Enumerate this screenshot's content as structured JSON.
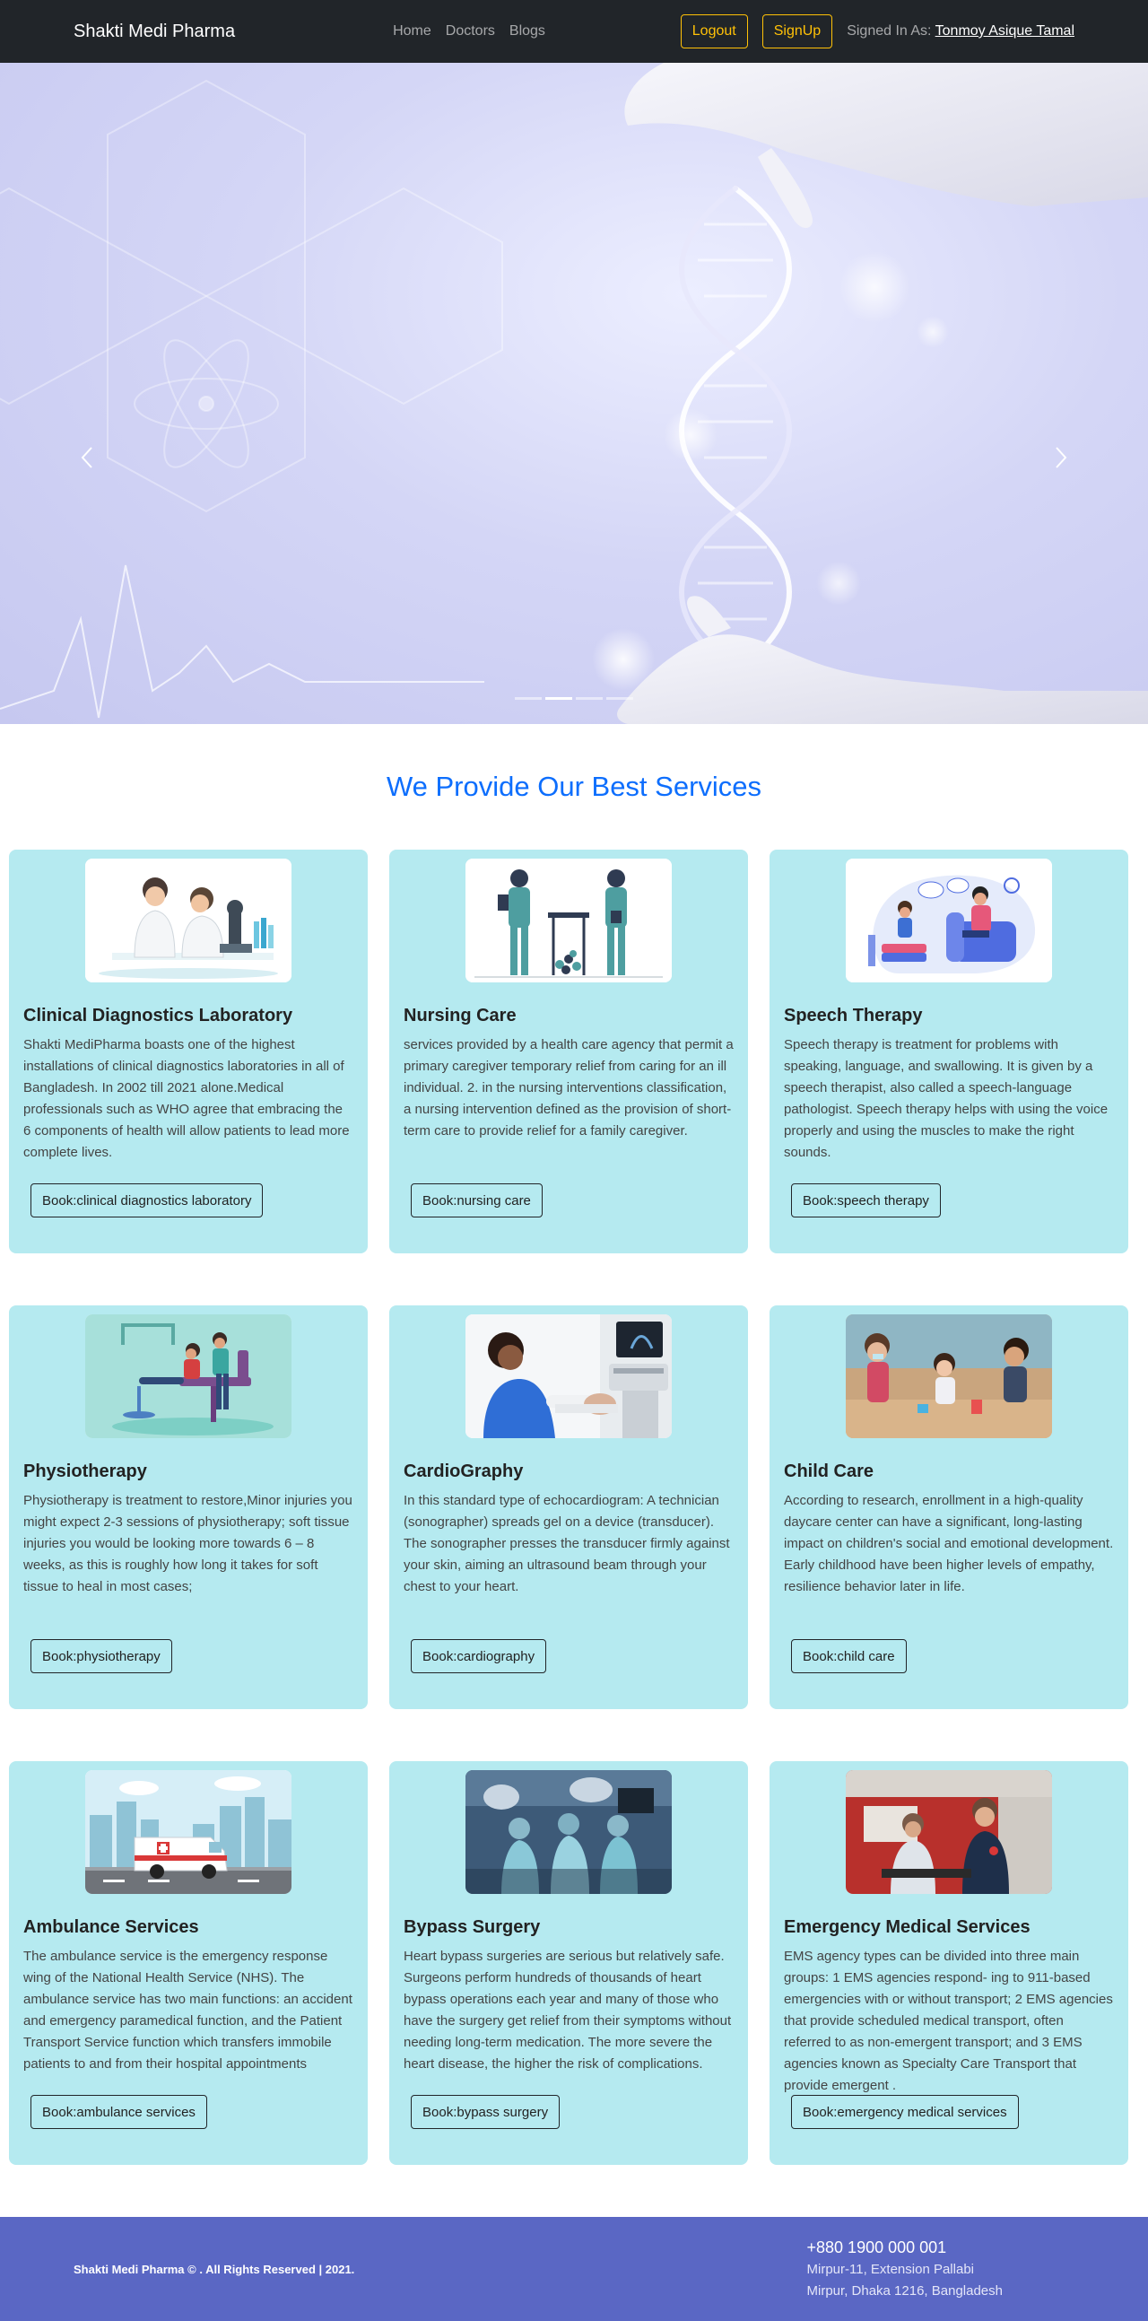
{
  "nav": {
    "brand": "Shakti Medi Pharma",
    "links": [
      "Home",
      "Doctors",
      "Blogs"
    ],
    "logout_label": "Logout",
    "signup_label": "SignUp",
    "signed_in_prefix": "Signed In As:",
    "signed_in_user": "Tonmoy Asique Tamal"
  },
  "hero": {
    "prev_icon": "chevron-left-icon",
    "next_icon": "chevron-right-icon",
    "slide_count": 4,
    "active_slide": 2
  },
  "services": {
    "title": "We Provide Our Best Services",
    "cards": [
      {
        "title": "Clinical Diagnostics Laboratory",
        "text": "Shakti MediPharma boasts one of the highest installations of clinical diagnostics laboratories in all of Bangladesh. In 2002 till 2021 alone.Medical professionals such as WHO agree that embracing the 6 components of health will allow patients to lead more complete lives.",
        "button": "Book:clinical diagnostics laboratory"
      },
      {
        "title": "Nursing Care",
        "text": "services provided by a health care agency that permit a primary caregiver temporary relief from caring for an ill individual. 2. in the nursing interventions classification, a nursing intervention defined as the provision of short-term care to provide relief for a family caregiver.",
        "button": "Book:nursing care"
      },
      {
        "title": "Speech Therapy",
        "text": "Speech therapy is treatment for problems with speaking, language, and swallowing. It is given by a speech therapist, also called a speech-language pathologist. Speech therapy helps with using the voice properly and using the muscles to make the right sounds.",
        "button": "Book:speech therapy"
      },
      {
        "title": "Physiotherapy",
        "text": "Physiotherapy is treatment to restore,Minor injuries you might expect 2-3 sessions of physiotherapy; soft tissue injuries you would be looking more towards 6 – 8 weeks, as this is roughly how long it takes for soft tissue to heal in most cases;",
        "button": "Book:physiotherapy"
      },
      {
        "title": "CardioGraphy",
        "text": "In this standard type of echocardiogram: A technician (sonographer) spreads gel on a device (transducer). The sonographer presses the transducer firmly against your skin, aiming an ultrasound beam through your chest to your heart.",
        "button": "Book:cardiography"
      },
      {
        "title": "Child Care",
        "text": "According to research, enrollment in a high-quality daycare center can have a significant, long-lasting impact on children's social and emotional development. Early childhood have been higher levels of empathy, resilience behavior later in life.",
        "button": "Book:child care"
      },
      {
        "title": "Ambulance Services",
        "text": "The ambulance service is the emergency response wing of the National Health Service (NHS). The ambulance service has two main functions: an accident and emergency paramedical function, and the Patient Transport Service function which transfers immobile patients to and from their hospital appointments",
        "button": "Book:ambulance services"
      },
      {
        "title": "Bypass Surgery",
        "text": "Heart bypass surgeries are serious but relatively safe. Surgeons perform hundreds of thousands of heart bypass operations each year and many of those who have the surgery get relief from their symptoms without needing long-term medication. The more severe the heart disease, the higher the risk of complications.",
        "button": "Book:bypass surgery"
      },
      {
        "title": "Emergency Medical Services",
        "text": "EMS agency types can be divided into three main groups: 1 EMS agencies respond- ing to 911-based emergencies with or without transport; 2 EMS agencies that provide scheduled medical transport, often referred to as non-emergent transport; and 3 EMS agencies known as Specialty Care Transport that provide emergent .",
        "button": "Book:emergency medical services"
      }
    ]
  },
  "footer": {
    "copyright": "Shakti Medi Pharma © . All Rights Reserved | 2021.",
    "phone": "+880 1900 000 001",
    "address_line1": "Mirpur-11, Extension Pallabi",
    "address_line2": "Mirpur, Dhaka 1216, Bangladesh"
  },
  "colors": {
    "navbar": "#212529",
    "accent": "#0d6efd",
    "warning": "#ffc107",
    "card_bg": "#b5eaf0",
    "footer_bg": "#5a67c4"
  }
}
